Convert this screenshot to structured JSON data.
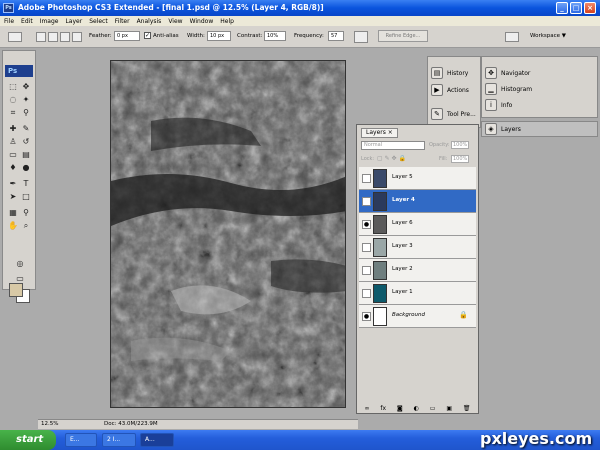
{
  "window": {
    "title": "Adobe Photoshop CS3 Extended - [final 1.psd @ 12.5% (Layer 4, RGB/8)]"
  },
  "menu": [
    "File",
    "Edit",
    "Image",
    "Layer",
    "Select",
    "Filter",
    "Analysis",
    "View",
    "Window",
    "Help"
  ],
  "options": {
    "feather_label": "Feather:",
    "feather_value": "0 px",
    "antialias_label": "Anti-alias",
    "width_label": "Width:",
    "width_value": "10 px",
    "contrast_label": "Contrast:",
    "contrast_value": "10%",
    "frequency_label": "Frequency:",
    "frequency_value": "57",
    "refine_edge_label": "Refine Edge...",
    "workspace_label": "Workspace ▼"
  },
  "toolbox": {
    "logo": "Ps"
  },
  "dock_left": [
    {
      "label": "History",
      "icon": "history-icon"
    },
    {
      "label": "Actions",
      "icon": "actions-icon"
    },
    {
      "label": "Tool Pre...",
      "icon": "tool-presets-icon"
    }
  ],
  "dock_right": [
    {
      "label": "Navigator",
      "icon": "navigator-icon"
    },
    {
      "label": "Histogram",
      "icon": "histogram-icon"
    },
    {
      "label": "Info",
      "icon": "info-icon"
    }
  ],
  "dock_layers_label": "Layers",
  "layers_panel": {
    "tab_label": "Layers",
    "blend_mode": "Normal",
    "opacity_label": "Opacity:",
    "opacity_value": "100%",
    "lock_label": "Lock:",
    "fill_label": "Fill:",
    "fill_value": "100%",
    "layers": [
      {
        "name": "Layer 5",
        "visible": false,
        "selected": false,
        "thumb_color": "#3a4a6a"
      },
      {
        "name": "Layer 4",
        "visible": false,
        "selected": true,
        "thumb_color": "#2b3a5c"
      },
      {
        "name": "Layer 6",
        "visible": true,
        "selected": false,
        "thumb_color": "#5a5a5a"
      },
      {
        "name": "Layer 3",
        "visible": false,
        "selected": false,
        "thumb_color": "#9aa7a7"
      },
      {
        "name": "Layer 2",
        "visible": false,
        "selected": false,
        "thumb_color": "#6f7f7f"
      },
      {
        "name": "Layer 1",
        "visible": false,
        "selected": false,
        "thumb_color": "#0e5a6b"
      },
      {
        "name": "Background",
        "visible": true,
        "selected": false,
        "thumb_color": "#ffffff"
      }
    ]
  },
  "status": {
    "zoom": "12.5%",
    "doc": "Doc: 43.0M/223.9M"
  },
  "taskbar": {
    "start_label": "start",
    "tasks": [
      {
        "label": "E..."
      },
      {
        "label": "2 I..."
      },
      {
        "label": "A..."
      }
    ]
  },
  "watermark": "pxleyes.com"
}
